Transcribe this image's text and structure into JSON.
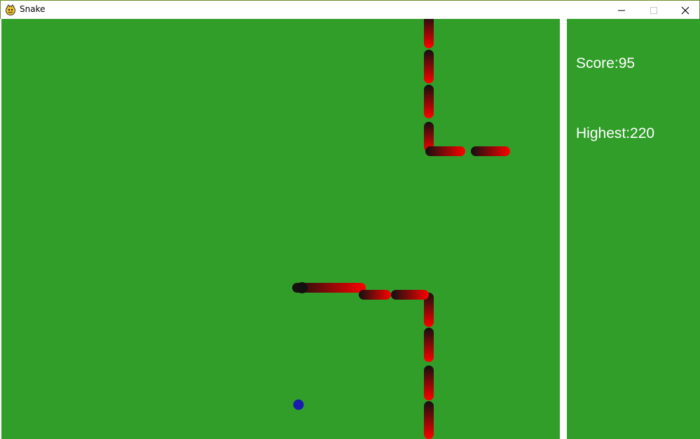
{
  "window": {
    "title": "Snake",
    "icon": "pygame-snake-icon",
    "controls": {
      "minimize": "minimize-icon",
      "maximize": "maximize-icon",
      "close": "close-icon"
    }
  },
  "panel": {
    "score_label": "Score:",
    "score_value": "95",
    "highest_label": "Highest:",
    "highest_value": "220"
  },
  "colors": {
    "field": "#319e2a",
    "snake_bright": "#ff0000",
    "snake_dark": "#111111",
    "food": "#1a1ab0",
    "divider": "#ffffff",
    "text": "#ffffff"
  }
}
